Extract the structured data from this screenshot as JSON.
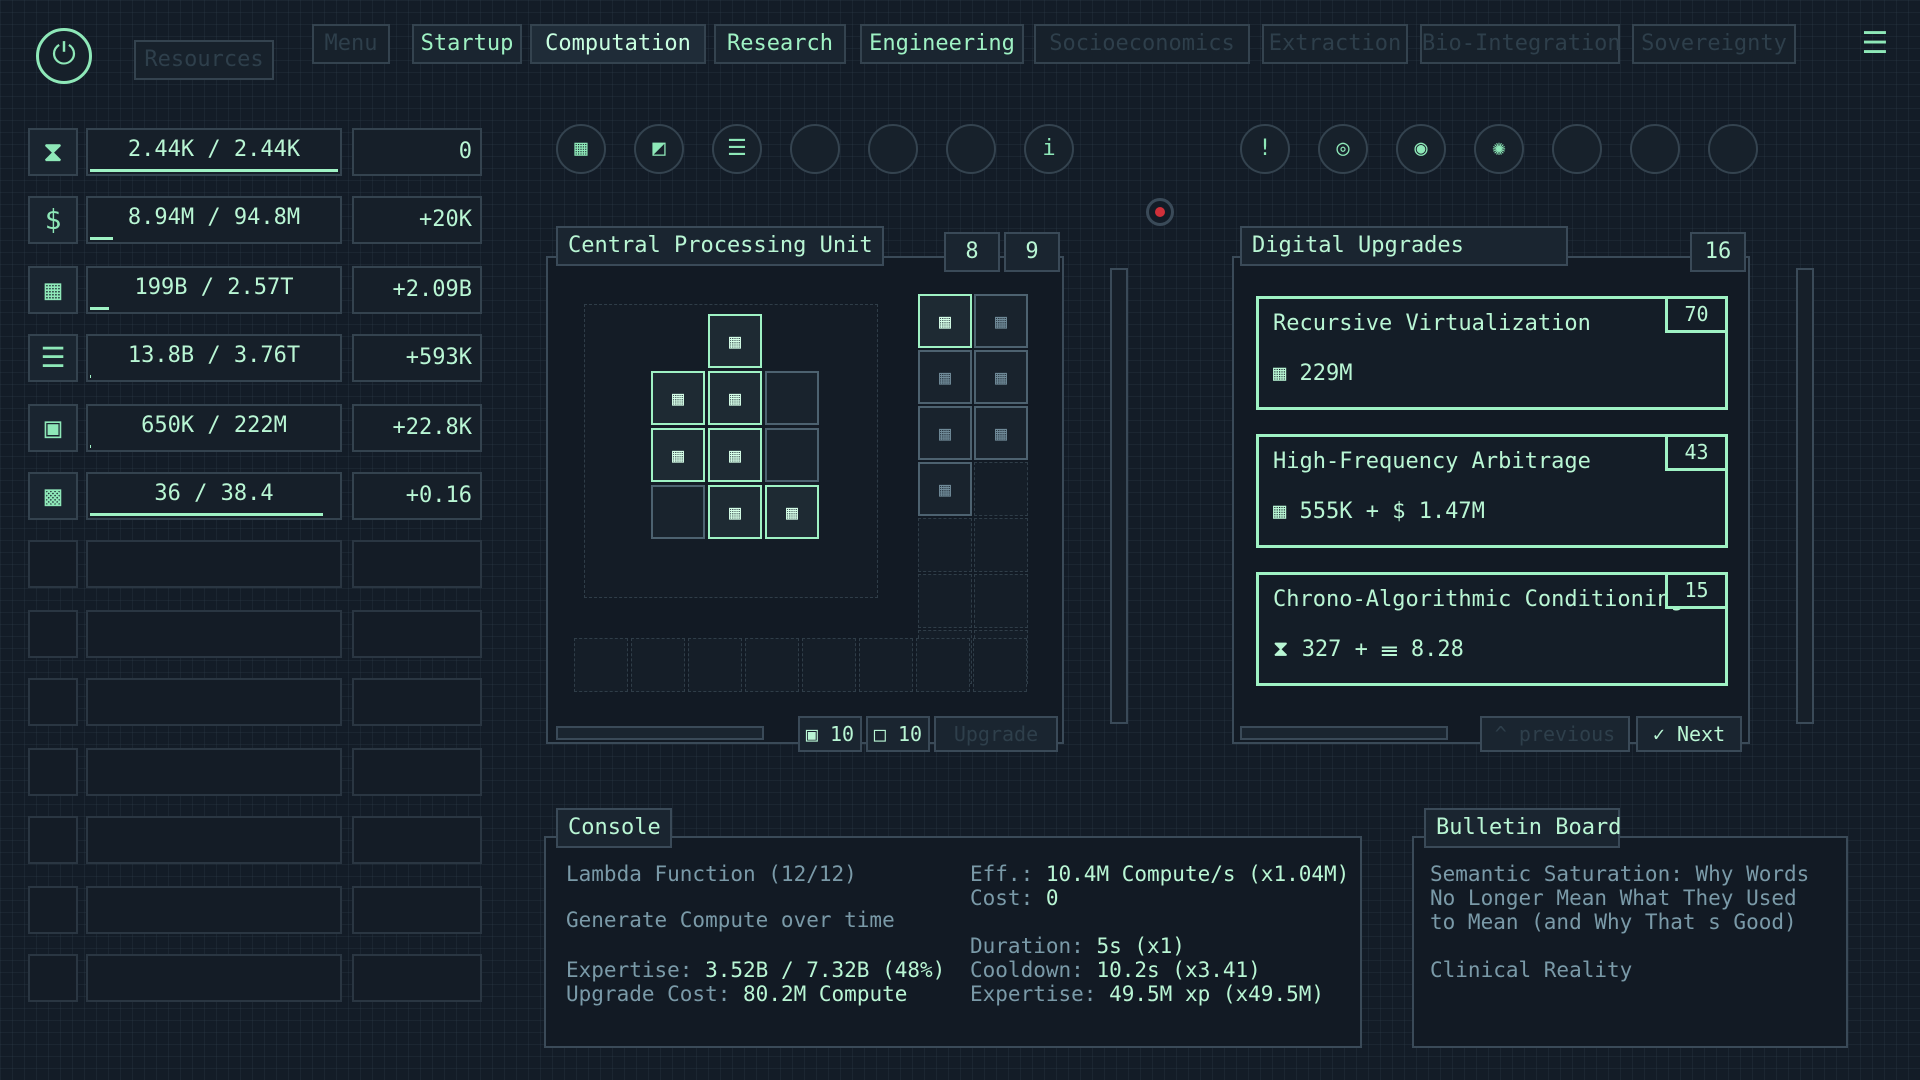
{
  "top": {
    "resources_label": "Resources",
    "menu_label": "Menu",
    "tabs": [
      {
        "label": "Startup"
      },
      {
        "label": "Computation"
      },
      {
        "label": "Research"
      },
      {
        "label": "Engineering"
      },
      {
        "label": "Socioeconomics"
      },
      {
        "label": "Extraction"
      },
      {
        "label": "Bio-Integration"
      },
      {
        "label": "Sovereignty"
      }
    ]
  },
  "resources": [
    {
      "icon": "hourglass-icon",
      "glyph": "⧗",
      "amount": "2.44K / 2.44K",
      "fill": 1.0,
      "rate": "0"
    },
    {
      "icon": "dollar-icon",
      "glyph": "$",
      "amount": "8.94M / 94.8M",
      "fill": 0.094,
      "rate": "+20K"
    },
    {
      "icon": "compute-icon",
      "glyph": "▦",
      "amount": "199B / 2.57T",
      "fill": 0.077,
      "rate": "+2.09B"
    },
    {
      "icon": "brain-icon",
      "glyph": "☰",
      "amount": "13.8B / 3.76T",
      "fill": 0.004,
      "rate": "+593K"
    },
    {
      "icon": "chip-icon",
      "glyph": "▣",
      "amount": "650K / 222M",
      "fill": 0.003,
      "rate": "+22.8K"
    },
    {
      "icon": "grid-chip-icon",
      "glyph": "▩",
      "amount": "36 / 38.4",
      "fill": 0.94,
      "rate": "+0.16"
    }
  ],
  "nodes_left": [
    "▦",
    "◩",
    "☰",
    "",
    "",
    "",
    "i"
  ],
  "nodes_right": [
    "!",
    "◎",
    "◉",
    "✺",
    "",
    "",
    ""
  ],
  "cpu": {
    "title": "Central Processing Unit",
    "n1": "8",
    "n2": "9",
    "chip_glyph": "▦",
    "footer_a": "▣ 10",
    "footer_b": "□ 10",
    "upgrade_label": "Upgrade"
  },
  "upgrades": {
    "title": "Digital Upgrades",
    "count": "16",
    "items": [
      {
        "name": "Recursive Virtualization",
        "level": "70",
        "cost": "▦  229M"
      },
      {
        "name": "High-Frequency Arbitrage",
        "level": "43",
        "cost": "▦  555K  +  $  1.47M"
      },
      {
        "name": "Chrono-Algorithmic Conditioning",
        "level": "15",
        "cost": "⧗  327  +  ☰  8.28"
      }
    ],
    "prev_label": "^ previous",
    "next_label": "✓ Next"
  },
  "console": {
    "title": "Console",
    "name": "Lambda Function (12/12)",
    "desc": "Generate Compute over time",
    "expertise_label": "Expertise:",
    "expertise_val": "3.52B / 7.32B (48%)",
    "upgrade_label": "Upgrade Cost:",
    "upgrade_val": "80.2M Compute",
    "eff_label": "Eff.:",
    "eff_val": "10.4M Compute/s (x1.04M)",
    "cost_label": "Cost:",
    "cost_val": "0",
    "duration_label": "Duration:",
    "duration_val": "5s (x1)",
    "cooldown_label": "Cooldown:",
    "cooldown_val": "10.2s (x3.41)",
    "xp_label": "Expertise:",
    "xp_val": "49.5M xp (x49.5M)"
  },
  "bulletin": {
    "title": "Bulletin Board",
    "line1": "Semantic Saturation: Why Words",
    "line2": "No Longer Mean What They Used",
    "line3": "to Mean (and Why That s Good)",
    "line4": "Clinical Reality"
  },
  "colors": {
    "accent": "#9ff2c4",
    "bg": "#131c27",
    "border": "#3a4a58",
    "alert": "#d0303a"
  }
}
